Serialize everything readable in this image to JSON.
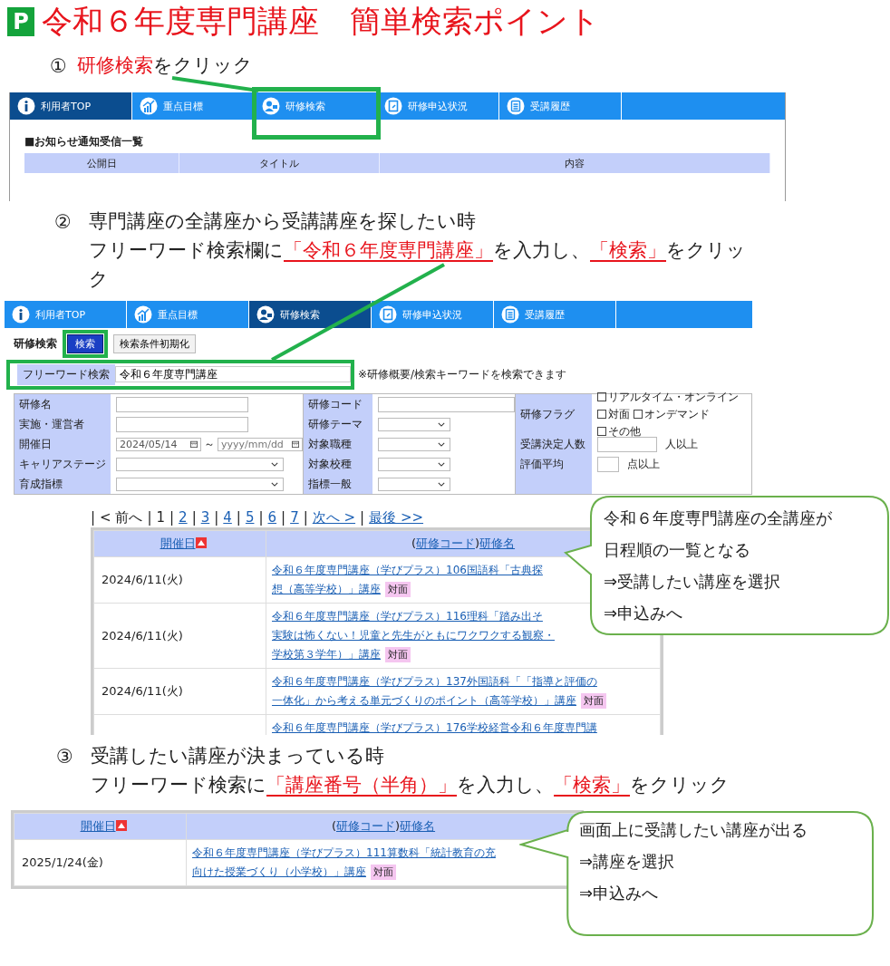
{
  "title_badge": "P",
  "title": "令和６年度専門講座　簡単検索ポイント",
  "step_1": {
    "number": "①",
    "lines": [
      [
        {
          "text": "研修検索",
          "kind": "red"
        },
        {
          "text": "をクリック",
          "kind": "plain"
        }
      ]
    ]
  },
  "screen_1": {
    "nav_tabs": [
      {
        "label": "利用者TOP",
        "selected": true
      },
      {
        "label": "重点目標",
        "selected": false
      },
      {
        "label": "研修検索",
        "selected": false
      },
      {
        "label": "研修申込状況",
        "selected": false
      },
      {
        "label": "受講履歴",
        "selected": false
      }
    ],
    "notice": {
      "heading": "■お知らせ通知受信一覧",
      "columns": [
        "公開日",
        "タイトル",
        "内容"
      ]
    }
  },
  "step_2": {
    "number": "②",
    "lines": [
      [
        {
          "text": "専門講座の全講座から受講講座を探したい時",
          "kind": "plain"
        }
      ],
      [
        {
          "text": "フリーワード検索欄に",
          "kind": "plain"
        },
        {
          "text": "「令和６年度専門講座」",
          "kind": "red_underline"
        },
        {
          "text": "を入力し、",
          "kind": "plain"
        },
        {
          "text": "「検索」",
          "kind": "red_underline"
        },
        {
          "text": "をクリック",
          "kind": "plain"
        }
      ]
    ]
  },
  "screen_2": {
    "nav_tabs": [
      {
        "label": "利用者TOP",
        "selected": false
      },
      {
        "label": "重点目標",
        "selected": false
      },
      {
        "label": "研修検索",
        "selected": true
      },
      {
        "label": "研修申込状況",
        "selected": false
      },
      {
        "label": "受講履歴",
        "selected": false
      }
    ],
    "search": {
      "heading": "研修検索",
      "search_button": "検索",
      "reset_button": "検索条件初期化",
      "freeword": {
        "label": "フリーワード検索",
        "value": "令和６年度専門講座",
        "note": "※研修概要/検索キーワードを検索できます"
      },
      "columns": [
        [
          {
            "label": "研修名",
            "kind": "text"
          },
          {
            "label": "実施・運営者",
            "kind": "text"
          },
          {
            "label": "開催日",
            "kind": "date_range",
            "value": "2024/05/14",
            "separator": "～",
            "placeholder": "yyyy/mm/dd"
          },
          {
            "label": "キャリアステージ",
            "kind": "select"
          },
          {
            "label": "育成指標",
            "kind": "select"
          }
        ],
        [
          {
            "label": "研修コード",
            "kind": "text"
          },
          {
            "label": "研修テーマ",
            "kind": "select"
          },
          {
            "label": "対象職種",
            "kind": "select"
          },
          {
            "label": "対象校種",
            "kind": "select"
          },
          {
            "label": "指標一般",
            "kind": "select"
          }
        ],
        [
          {
            "label": "研修フラグ",
            "kind": "checkboxes",
            "options": [
              {
                "label": "リアルタイム・オンライン",
                "checked": false
              },
              {
                "label": "対面",
                "checked": false
              },
              {
                "label": "オンデマンド",
                "checked": false
              },
              {
                "label": "その他",
                "checked": false
              }
            ]
          },
          {
            "label": "受講決定人数",
            "kind": "number",
            "suffix": "人以上"
          },
          {
            "label": "評価平均",
            "kind": "number",
            "suffix": "点以上"
          }
        ]
      ]
    }
  },
  "results_1": {
    "pagination": {
      "separator": "|",
      "items": [
        {
          "text": "< 前へ",
          "kind": "plain"
        },
        {
          "text": "1",
          "kind": "current"
        },
        {
          "text": "2",
          "kind": "link"
        },
        {
          "text": "3",
          "kind": "link"
        },
        {
          "text": "4",
          "kind": "link"
        },
        {
          "text": "5",
          "kind": "link"
        },
        {
          "text": "6",
          "kind": "link"
        },
        {
          "text": "7",
          "kind": "link"
        },
        {
          "text": "次へ >",
          "kind": "link"
        },
        {
          "text": "最後 >>",
          "kind": "link"
        }
      ]
    },
    "table": {
      "date_column": {
        "label": "開催日",
        "sorted": true
      },
      "title_column": [
        {
          "text": "(",
          "link": false
        },
        {
          "text": "研修コード",
          "link": true
        },
        {
          "text": ")",
          "link": false
        },
        {
          "text": "研修名",
          "link": true
        }
      ],
      "rows": [
        {
          "date": "2024/6/11(火)",
          "title_lines": [
            "令和６年度専門講座（学びプラス）106国語科「古典探",
            "想（高等学校）」講座"
          ],
          "badge": "対面"
        },
        {
          "date": "2024/6/11(火)",
          "title_lines": [
            "令和６年度専門講座（学びプラス）116理科「踏み出そ",
            "実験は怖くない！児童と先生がともにワクワクする観察・",
            "学校第３学年）」講座"
          ],
          "badge": "対面"
        },
        {
          "date": "2024/6/11(火)",
          "title_lines": [
            "令和６年度専門講座（学びプラス）137外国語科「「指導と評価の",
            "一体化」から考える単元づくりのポイント（高等学校）」講座"
          ],
          "badge": "対面"
        },
        {
          "title_lines": [
            "令和６年度専門講座（学びプラス）176学校経営令和６年度専門講"
          ]
        }
      ]
    },
    "callout": {
      "lines": [
        "令和６年度専門講座の全講座が",
        "日程順の一覧となる",
        "⇒受講したい講座を選択",
        "⇒申込みへ"
      ]
    }
  },
  "step_3": {
    "number": "③",
    "lines": [
      [
        {
          "text": "受講したい講座が決まっている時",
          "kind": "plain"
        }
      ],
      [
        {
          "text": "フリーワード検索に",
          "kind": "plain"
        },
        {
          "text": "「講座番号（半角）」",
          "kind": "red_underline"
        },
        {
          "text": "を入力し、",
          "kind": "plain"
        },
        {
          "text": "「検索」",
          "kind": "red_underline"
        },
        {
          "text": "をクリック",
          "kind": "plain"
        }
      ]
    ]
  },
  "results_2": {
    "table": {
      "date_column": {
        "label": "開催日",
        "sorted": true
      },
      "title_column": [
        {
          "text": "(",
          "link": false
        },
        {
          "text": "研修コード",
          "link": true
        },
        {
          "text": ")",
          "link": false
        },
        {
          "text": "研修名",
          "link": true
        }
      ],
      "rows": [
        {
          "date": "2025/1/24(金)",
          "title_lines": [
            "令和６年度専門講座（学びプラス）111算数科「統計教育の充",
            "向けた授業づくり（小学校）」講座"
          ],
          "badge": "対面"
        }
      ]
    },
    "callout": {
      "lines": [
        "画面上に受講したい講座が出る",
        "⇒講座を選択",
        "⇒申込みへ"
      ]
    }
  }
}
